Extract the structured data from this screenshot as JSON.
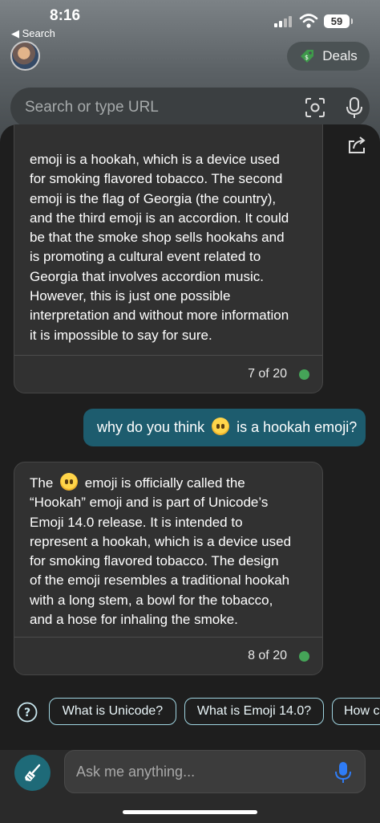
{
  "status_bar": {
    "time": "8:16",
    "back_label": "◀ Search",
    "battery": "59"
  },
  "header": {
    "deals_label": "Deals",
    "search_placeholder": "Search or type URL"
  },
  "chat": {
    "messages": [
      {
        "role": "bot",
        "lines": [
          "emoji is a hookah, which is a device used",
          "for smoking flavored tobacco. The second",
          "emoji is the flag of Georgia (the country),",
          "and the third emoji is an accordion. It could",
          "be that the smoke shop sells hookahs and",
          "is promoting a cultural event related to",
          "Georgia that involves accordion music.",
          "However, this is just one possible",
          "interpretation and without more information",
          "it is impossible to say for sure."
        ],
        "count": "7 of 20"
      },
      {
        "role": "user",
        "text_before": "why do you think",
        "text_after": "is a hookah emoji?"
      },
      {
        "role": "bot",
        "line1_before": "The",
        "line1_after": "emoji is officially called the",
        "lines": [
          "“Hookah” emoji and is part of Unicode’s",
          "Emoji 14.0 release. It is intended to",
          "represent a hookah, which is a device used",
          "for smoking flavored tobacco. The design",
          "of the emoji resembles a traditional hookah",
          "with a long stem, a bowl for the tobacco,",
          "and a hose for inhaling the smoke."
        ],
        "count": "8 of 20"
      }
    ]
  },
  "suggestions": [
    "What is Unicode?",
    "What is Emoji 14.0?",
    "How c"
  ],
  "composer": {
    "placeholder": "Ask me anything..."
  },
  "colors": {
    "accent": "#1e6a78",
    "user_bubble": "#1d5c6e",
    "status_dot": "#45a458",
    "mic_blue": "#2f7cf6"
  }
}
